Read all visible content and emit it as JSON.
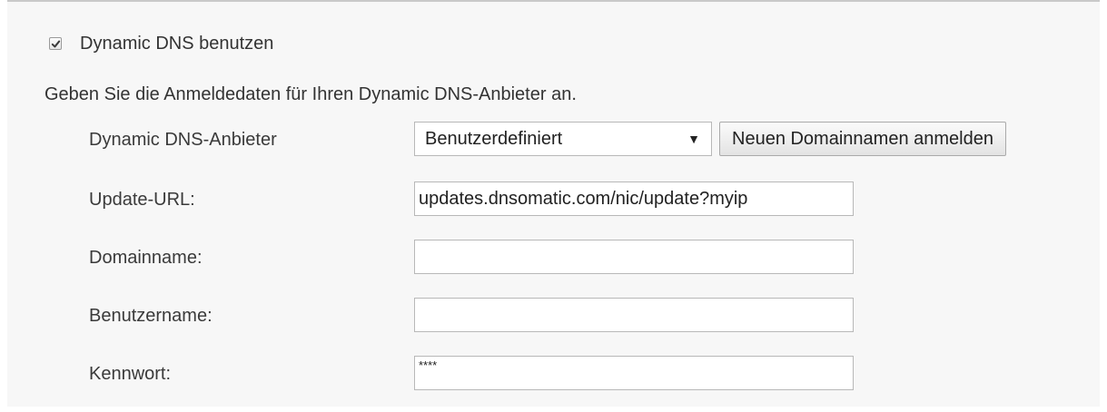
{
  "dynamic_dns": {
    "enable_checkbox": {
      "label": "Dynamic DNS benutzen",
      "checked": true
    },
    "intro_text": "Geben Sie die Anmeldedaten für Ihren Dynamic DNS-Anbieter an.",
    "provider": {
      "label": "Dynamic DNS-Anbieter",
      "selected": "Benutzerdefiniert",
      "arrow": "▼",
      "register_button": "Neuen Domainnamen anmelden"
    },
    "update_url": {
      "label": "Update-URL:",
      "value": "updates.dnsomatic.com/nic/update?myip"
    },
    "domain": {
      "label": "Domainname:",
      "value": ""
    },
    "username": {
      "label": "Benutzername:",
      "value": ""
    },
    "password": {
      "label": "Kennwort:",
      "value": "****"
    }
  }
}
